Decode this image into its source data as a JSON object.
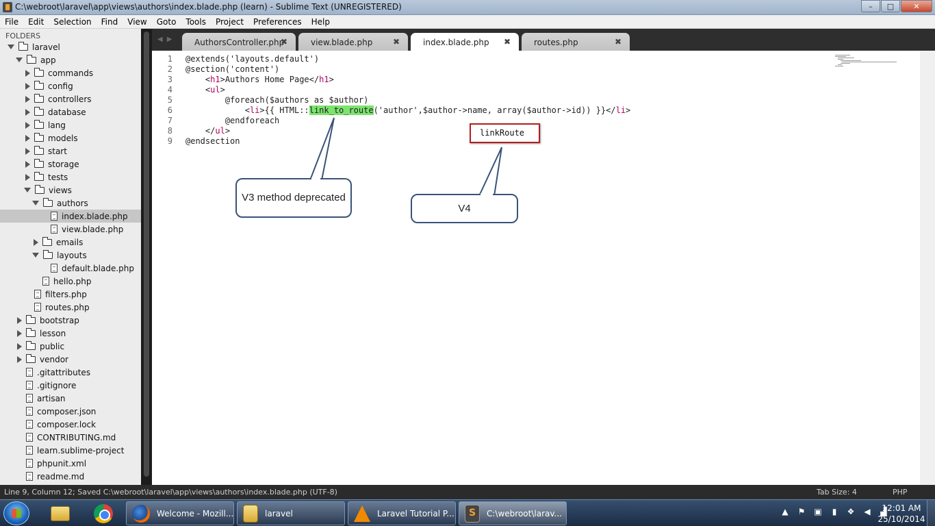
{
  "window": {
    "title": "C:\\webroot\\laravel\\app\\views\\authors\\index.blade.php (learn) - Sublime Text (UNREGISTERED)",
    "minimize": "–",
    "maximize": "□",
    "close": "✕"
  },
  "menu": [
    "File",
    "Edit",
    "Selection",
    "Find",
    "View",
    "Goto",
    "Tools",
    "Project",
    "Preferences",
    "Help"
  ],
  "sidebar": {
    "header": "FOLDERS",
    "items": [
      {
        "label": "laravel",
        "type": "folder",
        "open": true
      },
      {
        "label": "app",
        "type": "folder",
        "open": true
      },
      {
        "label": "commands",
        "type": "folder",
        "open": false
      },
      {
        "label": "config",
        "type": "folder",
        "open": false
      },
      {
        "label": "controllers",
        "type": "folder",
        "open": false
      },
      {
        "label": "database",
        "type": "folder",
        "open": false
      },
      {
        "label": "lang",
        "type": "folder",
        "open": false
      },
      {
        "label": "models",
        "type": "folder",
        "open": false
      },
      {
        "label": "start",
        "type": "folder",
        "open": false
      },
      {
        "label": "storage",
        "type": "folder",
        "open": false
      },
      {
        "label": "tests",
        "type": "folder",
        "open": false
      },
      {
        "label": "views",
        "type": "folder",
        "open": true
      },
      {
        "label": "authors",
        "type": "folder",
        "open": true
      },
      {
        "label": "index.blade.php",
        "type": "file",
        "selected": true
      },
      {
        "label": "view.blade.php",
        "type": "file"
      },
      {
        "label": "emails",
        "type": "folder",
        "open": false
      },
      {
        "label": "layouts",
        "type": "folder",
        "open": true
      },
      {
        "label": "default.blade.php",
        "type": "file"
      },
      {
        "label": "hello.php",
        "type": "file"
      },
      {
        "label": "filters.php",
        "type": "file"
      },
      {
        "label": "routes.php",
        "type": "file"
      },
      {
        "label": "bootstrap",
        "type": "folder",
        "open": false
      },
      {
        "label": "lesson",
        "type": "folder",
        "open": false
      },
      {
        "label": "public",
        "type": "folder",
        "open": false
      },
      {
        "label": "vendor",
        "type": "folder",
        "open": false
      },
      {
        "label": ".gitattributes",
        "type": "file"
      },
      {
        "label": ".gitignore",
        "type": "file"
      },
      {
        "label": "artisan",
        "type": "file"
      },
      {
        "label": "composer.json",
        "type": "file"
      },
      {
        "label": "composer.lock",
        "type": "file"
      },
      {
        "label": "CONTRIBUTING.md",
        "type": "file"
      },
      {
        "label": "learn.sublime-project",
        "type": "file"
      },
      {
        "label": "phpunit.xml",
        "type": "file"
      },
      {
        "label": "readme.md",
        "type": "file"
      }
    ]
  },
  "tabs": [
    {
      "label": "AuthorsController.php",
      "active": false
    },
    {
      "label": "view.blade.php",
      "active": false
    },
    {
      "label": "index.blade.php",
      "active": true
    },
    {
      "label": "routes.php",
      "active": false
    }
  ],
  "tab_close": "✖",
  "editor": {
    "lines": [
      {
        "num": "1",
        "text": "@extends('layouts.default')"
      },
      {
        "num": "2",
        "text": "@section('content')"
      },
      {
        "num": "3",
        "indent": "    ",
        "open": "<",
        "tag": "h1",
        "gt": ">",
        "body": "Authors Home Page",
        "close": "</",
        "tag2": "h1",
        "end": ">"
      },
      {
        "num": "4",
        "indent": "    ",
        "open": "<",
        "tag": "ul",
        "gt": ">"
      },
      {
        "num": "5",
        "text": "        @foreach($authors as $author)"
      },
      {
        "num": "6",
        "indent": "            ",
        "open": "<",
        "tag": "li",
        "gt": ">",
        "pre": "{{ HTML::",
        "hl": "link_to_route",
        "post": "('author',$author->name, array($author->id)) }}",
        "close": "</",
        "tag2": "li",
        "end": ">"
      },
      {
        "num": "7",
        "text": "        @endforeach"
      },
      {
        "num": "8",
        "indent": "    ",
        "close": "</",
        "tag2": "ul",
        "end": ">"
      },
      {
        "num": "9",
        "text": "@endsection"
      }
    ]
  },
  "annotations": {
    "v3_text": "V3 method deprecated",
    "v4_text": "V4",
    "new_method": "linkRoute"
  },
  "status": {
    "left": "Line 9, Column 12; Saved C:\\webroot\\laravel\\app\\views\\authors\\index.blade.php (UTF-8)",
    "tab_size": "Tab Size: 4",
    "syntax": "PHP"
  },
  "taskbar": {
    "buttons": [
      {
        "label": "Welcome - Mozill..."
      },
      {
        "label": "laravel"
      },
      {
        "label": "Laravel Tutorial P..."
      },
      {
        "label": "C:\\webroot\\larav..."
      }
    ],
    "time": "12:01 AM",
    "date": "25/10/2014"
  }
}
